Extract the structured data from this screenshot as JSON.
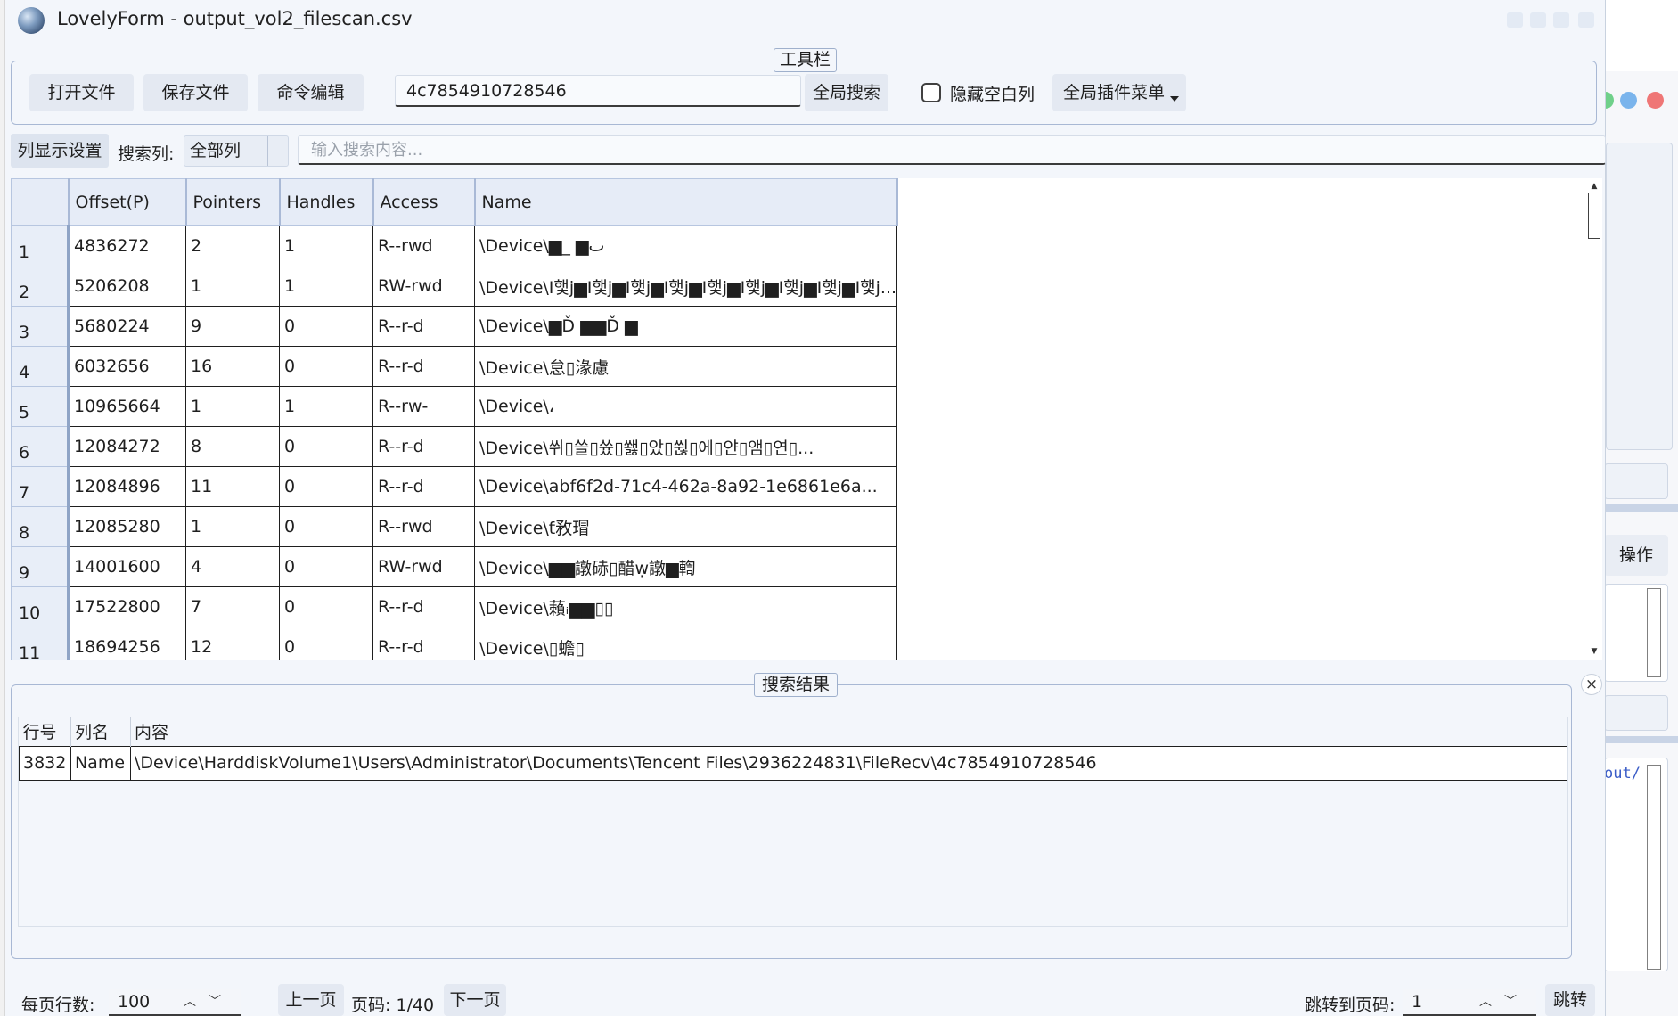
{
  "window": {
    "title": "LovelyForm - output_vol2_filescan.csv"
  },
  "toolbar": {
    "legend": "工具栏",
    "open_file": "打开文件",
    "save_file": "保存文件",
    "command_edit": "命令编辑",
    "search_value": "4c7854910728546",
    "global_search": "全局搜索",
    "hide_empty_columns": "隐藏空白列",
    "hide_empty_checked": false,
    "plugin_menu": "全局插件菜单"
  },
  "search_row": {
    "column_settings": "列显示设置",
    "search_column_label": "搜索列:",
    "search_column_value": "全部列",
    "content_placeholder": "输入搜索内容..."
  },
  "grid": {
    "columns": [
      "Offset(P)",
      "Pointers",
      "Handles",
      "Access",
      "Name"
    ],
    "rows": [
      {
        "n": "1",
        "offset": "4836272",
        "pointers": "2",
        "handles": "1",
        "access": "R--rwd",
        "name": "\\Device\\▆_  ▆ٮ"
      },
      {
        "n": "2",
        "offset": "5206208",
        "pointers": "1",
        "handles": "1",
        "access": "RW-rwd",
        "name": "\\Device\\I햋j▆I햋j▆I햋j▆I햋j▆I햋j▆I햋j▆I햋j▆I햋j▆I햋j..."
      },
      {
        "n": "3",
        "offset": "5680224",
        "pointers": "9",
        "handles": "0",
        "access": "R--r-d",
        "name": "\\Device\\▆Ď   ▆▆Ď   ▆"
      },
      {
        "n": "4",
        "offset": "6032656",
        "pointers": "16",
        "handles": "0",
        "access": "R--r-d",
        "name": "\\Device\\怠▯湪慮"
      },
      {
        "n": "5",
        "offset": "10965664",
        "pointers": "1",
        "handles": "1",
        "access": "R--rw-",
        "name": "\\Device\\،"
      },
      {
        "n": "6",
        "offset": "12084272",
        "pointers": "8",
        "handles": "0",
        "access": "R--r-d",
        "name": "\\Device\\쒸▯쓸▯쓨▯쐟▯았▯쒾▯에▯얀▯앰▯연▯..."
      },
      {
        "n": "7",
        "offset": "12084896",
        "pointers": "11",
        "handles": "0",
        "access": "R--r-d",
        "name": "\\Device\\abf6f2d-71c4-462a-8a92-1e6861e6a..."
      },
      {
        "n": "8",
        "offset": "12085280",
        "pointers": "1",
        "handles": "0",
        "access": "R--rwd",
        "name": "\\Device\\ƭ敄瑁"
      },
      {
        "n": "9",
        "offset": "14001600",
        "pointers": "4",
        "handles": "0",
        "access": "RW-rwd",
        "name": "\\Device\\▆▆譈硳▯醋ẉ譈▆輷"
      },
      {
        "n": "10",
        "offset": "17522800",
        "pointers": "7",
        "handles": "0",
        "access": "R--r-d",
        "name": "\\Device\\藾ᵢ▆▆▯▯"
      },
      {
        "n": "11",
        "offset": "18694256",
        "pointers": "12",
        "handles": "0",
        "access": "R--r-d",
        "name": "\\Device\\▯蟾▯"
      }
    ]
  },
  "results": {
    "legend": "搜索结果",
    "close": "×",
    "columns": [
      "行号",
      "列名",
      "内容"
    ],
    "rows": [
      {
        "row": "3832",
        "col": "Name",
        "content": "\\Device\\HarddiskVolume1\\Users\\Administrator\\Documents\\Tencent Files\\2936224831\\FileRecv\\4c7854910728546"
      }
    ]
  },
  "footer": {
    "rows_per_page_label": "每页行数:",
    "rows_per_page_value": "100",
    "prev_page": "上一页",
    "page_info": "页码: 1/40",
    "next_page": "下一页",
    "goto_label": "跳转到页码:",
    "goto_value": "1",
    "goto_button": "跳转"
  },
  "background_window": {
    "action_label": "操作",
    "code_text": "out/"
  },
  "colors": {
    "window_bg": "#f3f6fb",
    "header_bg": "#e6ecf7",
    "button_bg": "#e4e9f2",
    "accent_border": "#a8b8d4",
    "mac_green": "#4cc26a",
    "mac_blue": "#6aa8e8",
    "mac_red": "#ee6f6f"
  }
}
